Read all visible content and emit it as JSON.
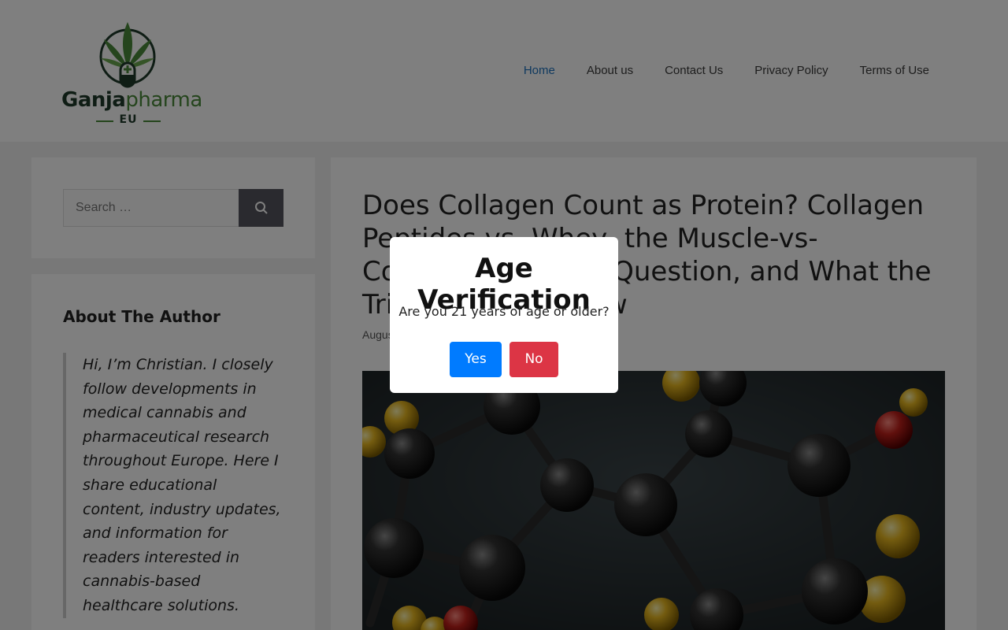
{
  "header": {
    "logo": {
      "word_part1": "Ganja",
      "word_part2": "pharma",
      "sub": "EU"
    },
    "nav": [
      {
        "label": "Home",
        "active": true
      },
      {
        "label": "About us"
      },
      {
        "label": "Contact Us"
      },
      {
        "label": "Privacy Policy"
      },
      {
        "label": "Terms of Use"
      }
    ]
  },
  "sidebar": {
    "search": {
      "placeholder": "Search …"
    },
    "author": {
      "title": "About The Author",
      "bio": "Hi, I’m Christian. I closely follow developments in medical cannabis and pharmaceutical research throughout Europe. Here I share educational content, industry updates, and information for readers interested in cannabis-based healthcare solutions."
    }
  },
  "article": {
    "title": "Does Collagen Count as Protein? Collagen Peptides vs. Whey, the Muscle-vs-Connective-Tissue Question, and What the Trials Actually Show",
    "date": "August"
  },
  "modal": {
    "title": "Age Verification",
    "question": "Are you 21 years of age or older?",
    "yes_label": "Yes",
    "no_label": "No"
  },
  "colors": {
    "nav_active": "#1e73be",
    "yes_button": "#007bff",
    "no_button": "#dc3545",
    "logo_dark": "#1f3a2a",
    "logo_green": "#4a8a3a"
  }
}
